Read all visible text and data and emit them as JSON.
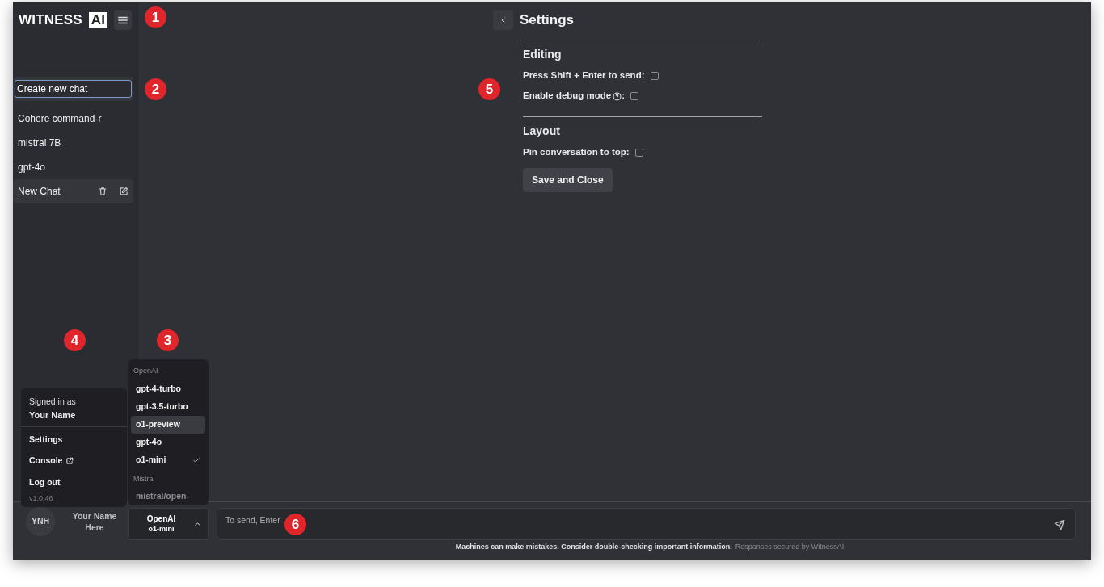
{
  "logo": {
    "text": "WITNESS",
    "badge": "AI"
  },
  "sidebar": {
    "new_chat": {
      "value": "Create new chat"
    },
    "chats": [
      {
        "label": "Cohere command-r",
        "selected": false
      },
      {
        "label": "mistral 7B",
        "selected": false
      },
      {
        "label": "gpt-4o",
        "selected": false
      },
      {
        "label": "New Chat",
        "selected": true
      }
    ]
  },
  "settings": {
    "title": "Settings",
    "sections": [
      {
        "heading": "Editing",
        "options": [
          {
            "label": "Press Shift + Enter to send",
            "help": false,
            "suffix": ":",
            "checked": false
          },
          {
            "label": "Enable debug mode",
            "help": true,
            "suffix": ":",
            "checked": false
          }
        ]
      },
      {
        "heading": "Layout",
        "options": [
          {
            "label": "Pin conversation to top",
            "help": false,
            "suffix": ":",
            "checked": false
          }
        ]
      }
    ],
    "save_button": "Save and Close"
  },
  "user_menu": {
    "caption": "Signed in as",
    "name": "Your Name",
    "items": [
      {
        "label": "Settings",
        "external": false
      },
      {
        "label": "Console",
        "external": true
      },
      {
        "label": "Log out",
        "external": false
      }
    ],
    "version": "v1.0.46"
  },
  "model_menu": {
    "groups": [
      {
        "label": "OpenAI",
        "models": [
          {
            "label": "gpt-4-turbo",
            "selected": false,
            "hovered": false
          },
          {
            "label": "gpt-3.5-turbo",
            "selected": false,
            "hovered": false
          },
          {
            "label": "o1-preview",
            "selected": false,
            "hovered": true
          },
          {
            "label": "gpt-4o",
            "selected": false,
            "hovered": false
          },
          {
            "label": "o1-mini",
            "selected": true,
            "hovered": false
          }
        ]
      },
      {
        "label": "Mistral",
        "models": [
          {
            "label": "mistral/open-",
            "selected": false,
            "hovered": false
          }
        ]
      }
    ]
  },
  "user": {
    "initials": "YNH",
    "name": "Your Name Here"
  },
  "model_button": {
    "provider": "OpenAI",
    "model": "o1-mini",
    "expanded": true
  },
  "composer": {
    "placeholder": "To send, Enter"
  },
  "footer": {
    "notice": "Machines can make mistakes. Consider double-checking important information.",
    "secured": "Responses secured by WitnessAI"
  },
  "callouts": [
    "1",
    "2",
    "3",
    "4",
    "5",
    "6"
  ]
}
